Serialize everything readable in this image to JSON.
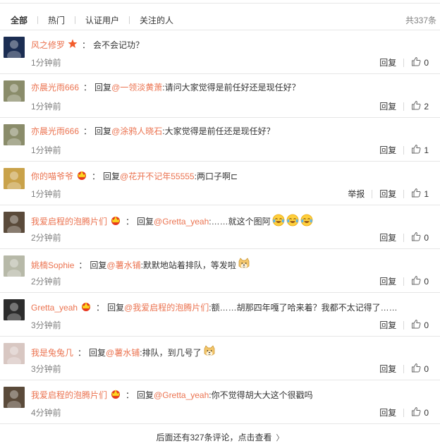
{
  "filters": {
    "tabs": [
      "全部",
      "热门",
      "认证用户",
      "关注的人"
    ],
    "total": "共337条"
  },
  "colors": {
    "username": "#eb7350",
    "muted": "#808080",
    "rule": "#e6e6e6"
  },
  "comments": [
    {
      "user": "风之修罗",
      "badge": "star-icon",
      "reply": "",
      "mention": "",
      "text": "会不会记功？",
      "emojis": [],
      "time": "1分钟前",
      "report": "",
      "reply_label": "回复",
      "likes": "0",
      "avatar_color": "#1b2d52"
    },
    {
      "user": "亦晨光雨666",
      "badge": "",
      "reply": "回复",
      "mention": "@一领淡黄萧",
      "text": ":请问大家觉得是前任好还是现任好？",
      "emojis": [],
      "time": "1分钟前",
      "report": "",
      "reply_label": "回复",
      "likes": "2",
      "avatar_color": "#8a8c6a"
    },
    {
      "user": "亦晨光雨666",
      "badge": "",
      "reply": "回复",
      "mention": "@涂鸦人晓石",
      "text": ":大家觉得是前任还是现任好？",
      "emojis": [],
      "time": "1分钟前",
      "report": "",
      "reply_label": "回复",
      "likes": "1",
      "avatar_color": "#8a8c6a"
    },
    {
      "user": "你的喵爷爷",
      "badge": "crown-icon",
      "reply": "回复",
      "mention": "@花开不记年55555",
      "text": ":两口子啊⊏",
      "emojis": [],
      "time": "1分钟前",
      "report": "举报",
      "reply_label": "回复",
      "likes": "1",
      "avatar_color": "#c9a24a"
    },
    {
      "user": "我爱启程的泡腾片们",
      "badge": "crown-icon",
      "reply": "回复",
      "mention": "@Gretta_yeah",
      "text": ":……就这个图阿",
      "emojis": [
        "laugh-cry-emoji",
        "laugh-cry-emoji",
        "laugh-cry-emoji"
      ],
      "time": "2分钟前",
      "report": "",
      "reply_label": "回复",
      "likes": "0",
      "avatar_color": "#5a4a3a"
    },
    {
      "user": "姚楠Sophie",
      "badge": "",
      "reply": "回复",
      "mention": "@薯水铺",
      "text": ":默默地站着排队，等发啦",
      "emojis": [
        "doge-emoji"
      ],
      "time": "2分钟前",
      "report": "",
      "reply_label": "回复",
      "likes": "0",
      "avatar_color": "#b7b9a8"
    },
    {
      "user": "Gretta_yeah",
      "badge": "crown-icon",
      "reply": "回复",
      "mention": "@我爱启程的泡腾片们",
      "text": ":额……胡那四年嘎了哈来着？我都不太记得了……",
      "emojis": [],
      "time": "3分钟前",
      "report": "",
      "reply_label": "回复",
      "likes": "0",
      "avatar_color": "#2c2c2c"
    },
    {
      "user": "我是兔兔几",
      "badge": "",
      "reply": "回复",
      "mention": "@薯水铺",
      "text": ":排队，到几号了",
      "emojis": [
        "doge-emoji"
      ],
      "time": "3分钟前",
      "report": "",
      "reply_label": "回复",
      "likes": "0",
      "avatar_color": "#d8c7c2"
    },
    {
      "user": "我爱启程的泡腾片们",
      "badge": "crown-icon",
      "reply": "回复",
      "mention": "@Gretta_yeah",
      "text": ":你不觉得胡大大这个很戳吗",
      "emojis": [],
      "time": "4分钟前",
      "report": "",
      "reply_label": "回复",
      "likes": "0",
      "avatar_color": "#5a4a3a"
    }
  ],
  "footer": {
    "more": "后面还有327条评论，点击查看",
    "arrow": "〉"
  }
}
